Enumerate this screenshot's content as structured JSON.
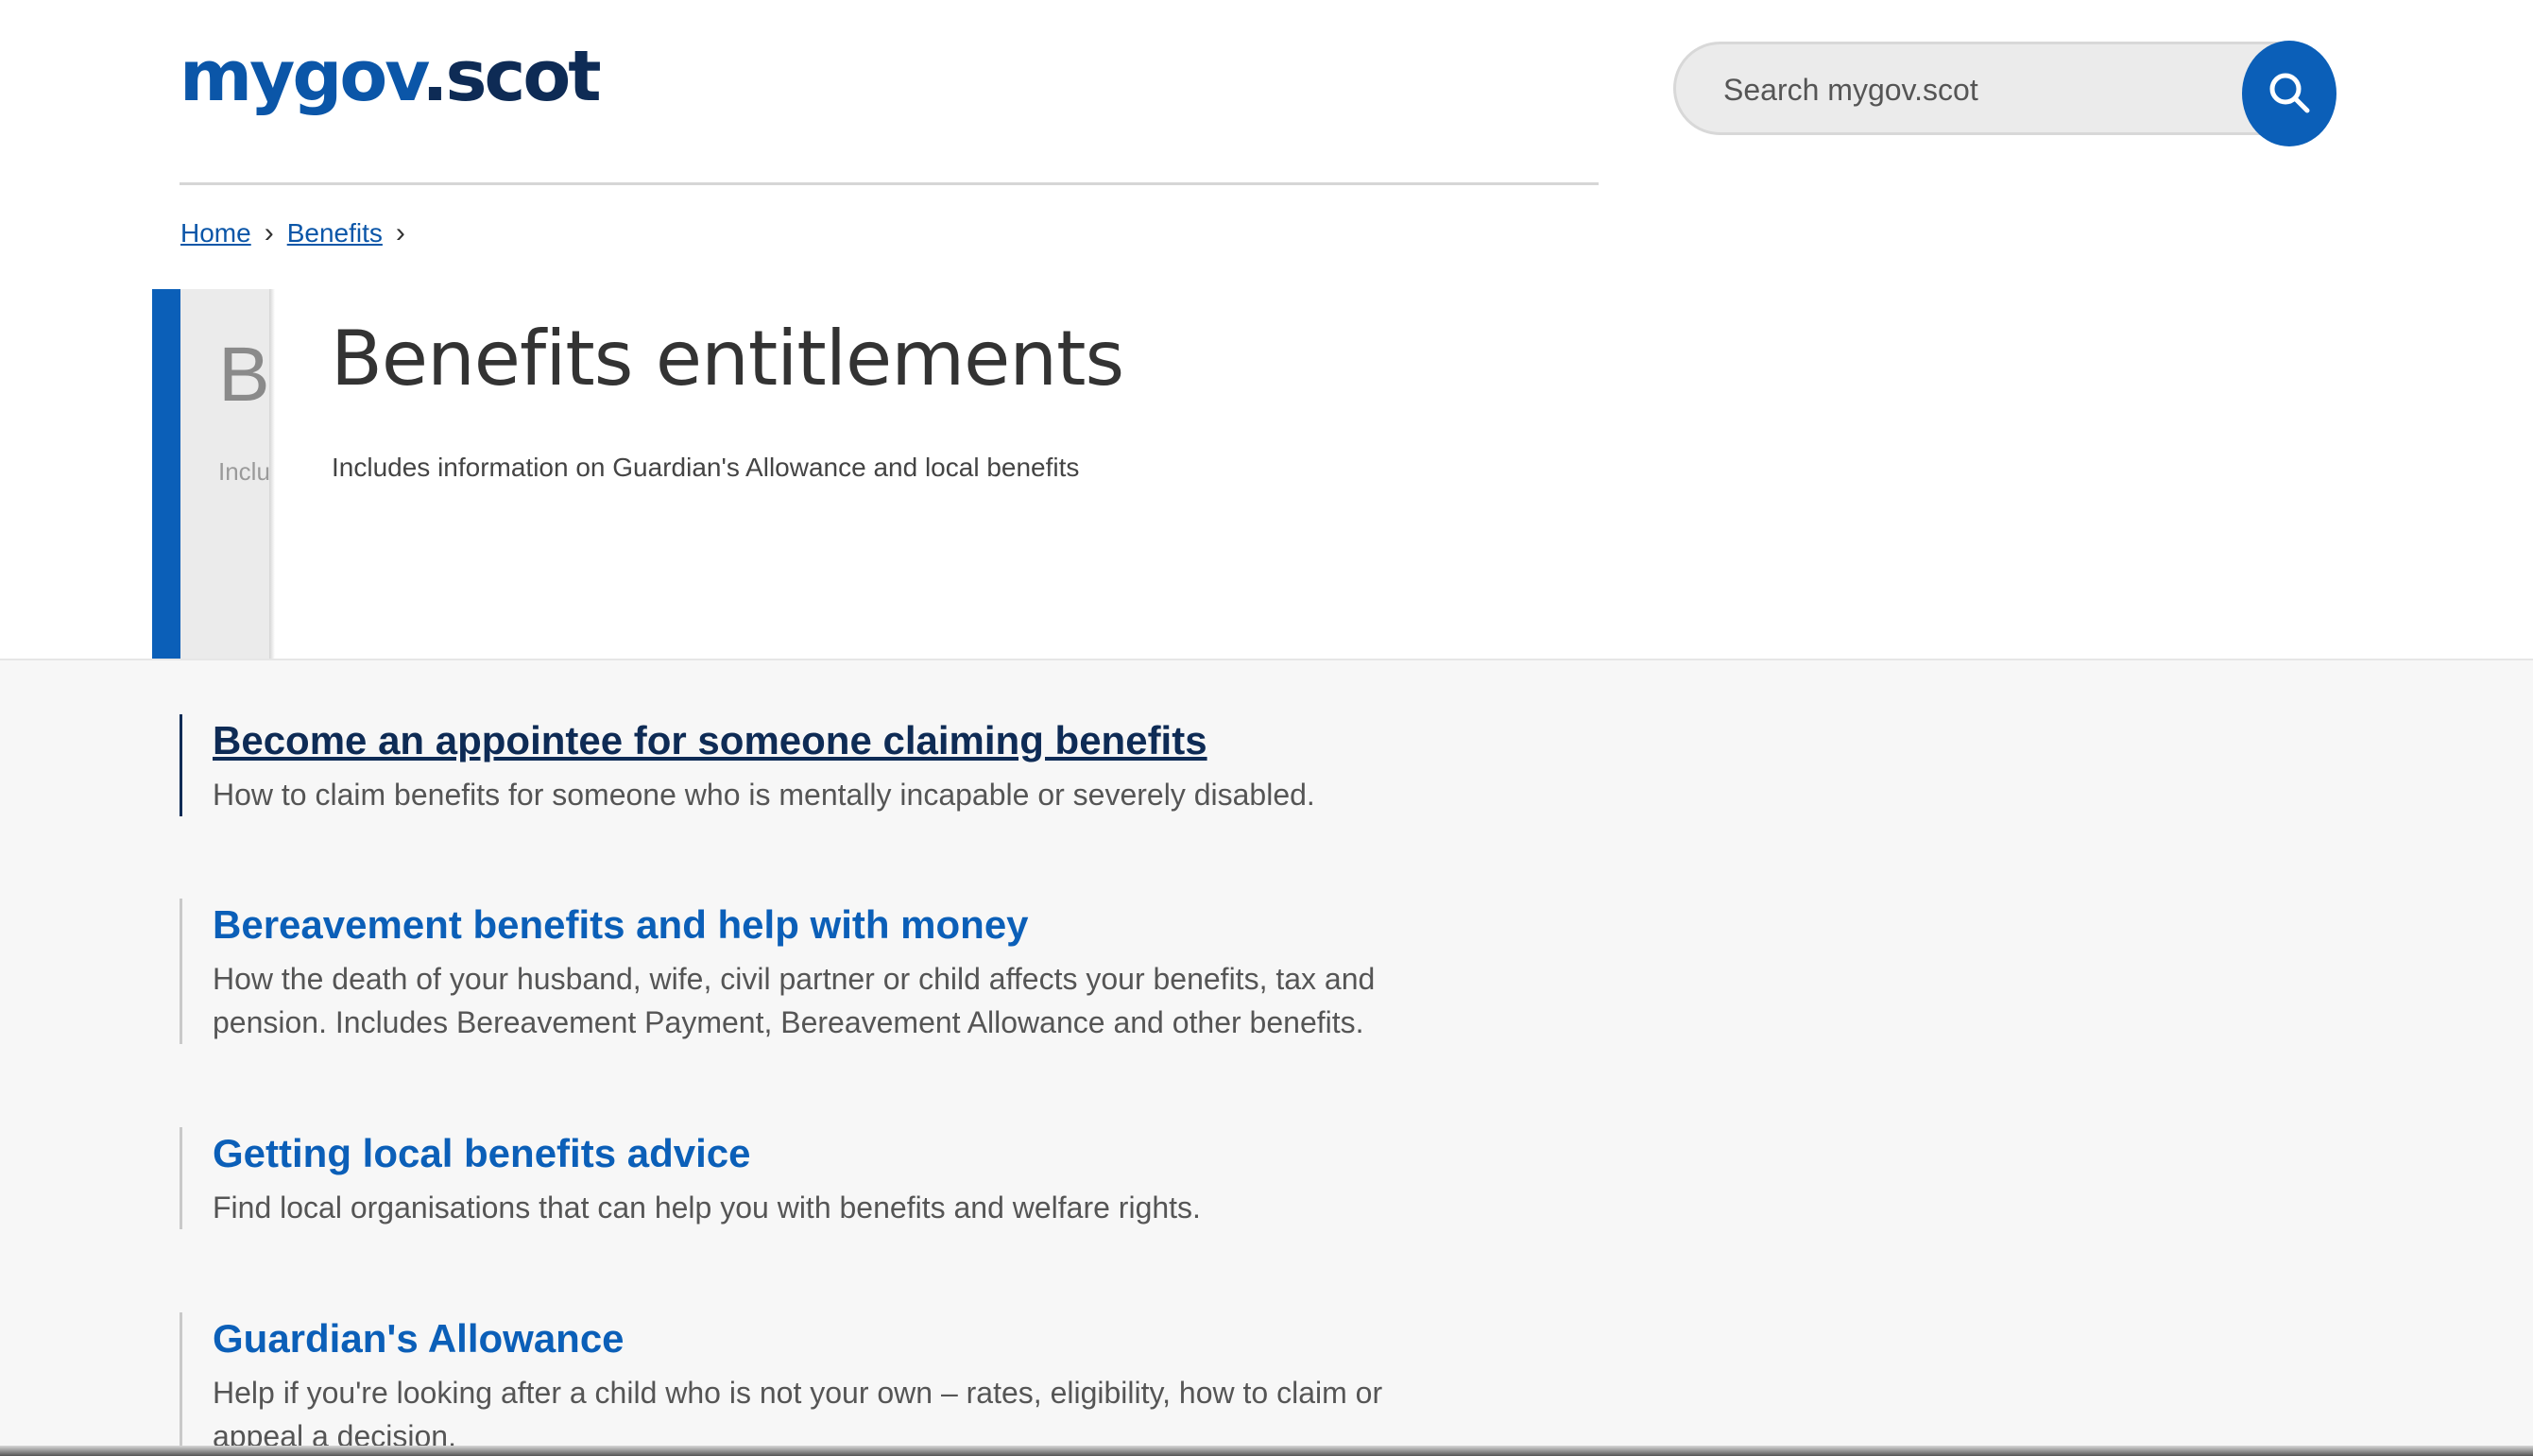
{
  "header": {
    "logo_primary": "mygov",
    "logo_secondary": ".scot",
    "search_placeholder": "Search mygov.scot"
  },
  "breadcrumb": {
    "items": [
      "Home",
      "Benefits"
    ],
    "separator": "›"
  },
  "hero": {
    "ghost_title": "Be",
    "ghost_subtitle": "Inclu",
    "title": "Benefits entitlements",
    "subtitle": "Includes information on Guardian's Allowance and local benefits"
  },
  "list": {
    "items": [
      {
        "title": "Become an appointee for someone claiming benefits",
        "description": "How to claim benefits for someone who is mentally incapable or severely disabled."
      },
      {
        "title": "Bereavement benefits and help with money",
        "description": "How the death of your husband, wife, civil partner or child affects your benefits, tax and pension. Includes Bereavement Payment, Bereavement Allowance and other benefits."
      },
      {
        "title": "Getting local benefits advice",
        "description": "Find local organisations that can help you with benefits and welfare rights."
      },
      {
        "title": "Guardian's Allowance",
        "description": "Help if you're looking after a child who is not your own – rates, eligibility, how to claim or appeal a decision."
      }
    ]
  },
  "colors": {
    "brand_blue": "#0b5fb8",
    "brand_navy": "#0e2b55",
    "panel_grey": "#f7f7f7"
  },
  "icons": {
    "search": "search-icon"
  }
}
